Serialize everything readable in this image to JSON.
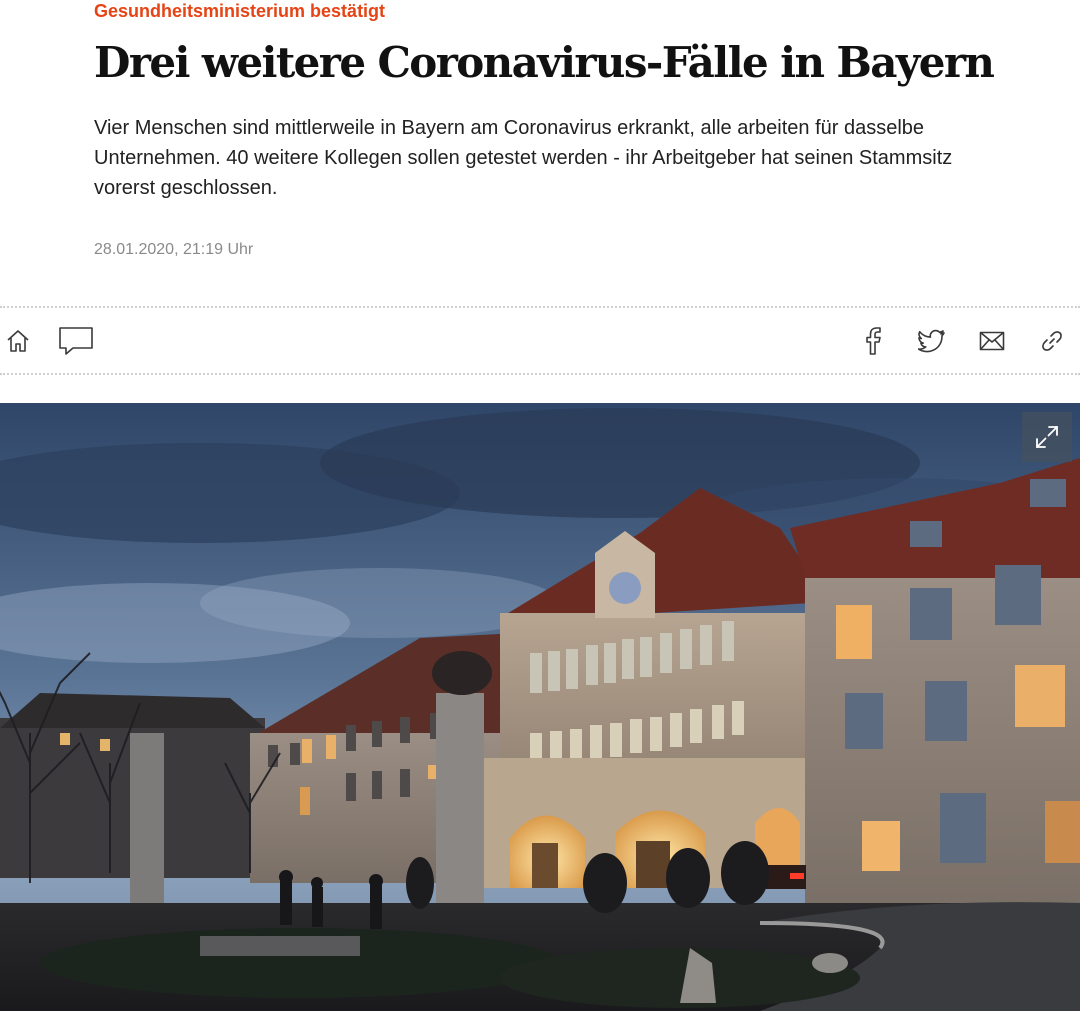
{
  "article": {
    "kicker": "Gesundheitsministerium bestätigt",
    "headline": "Drei weitere Coronavirus-Fälle in Bayern",
    "lead": "Vier Menschen sind mittlerweile in Bayern am Coronavirus erkrankt, alle arbeiten für dasselbe Unternehmen. 40 weitere Kollegen sollen getestet werden - ihr Arbeitgeber hat seinen Stammsitz vorerst geschlossen.",
    "timestamp": "28.01.2020, 21:19 Uhr"
  },
  "toolbar": {
    "left": [
      {
        "icon": "home-icon"
      },
      {
        "icon": "comment-icon"
      }
    ],
    "share": [
      {
        "icon": "facebook-icon"
      },
      {
        "icon": "twitter-icon"
      },
      {
        "icon": "mail-icon"
      },
      {
        "icon": "link-icon"
      }
    ]
  },
  "hero": {
    "expand_icon": "expand-icon"
  },
  "colors": {
    "kicker": "#e64415",
    "headline": "#111111",
    "body_text": "#222222",
    "timestamp": "#8a8a8a",
    "divider": "#cfcfcf",
    "icon": "#3a3a3a"
  }
}
